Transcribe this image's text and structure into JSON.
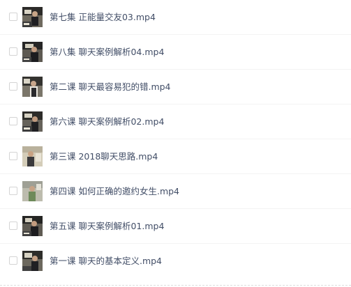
{
  "files": [
    {
      "name": "第七集 正能量交友03.mp4",
      "thumb_style": "dark"
    },
    {
      "name": "第八集 聊天案例解析04.mp4",
      "thumb_style": "dark"
    },
    {
      "name": "第二课 聊天最容易犯的错.mp4",
      "thumb_style": "dark"
    },
    {
      "name": "第六课 聊天案例解析02.mp4",
      "thumb_style": "dark"
    },
    {
      "name": "第三课 2018聊天思路.mp4",
      "thumb_style": "light"
    },
    {
      "name": "第四课 如何正确的邀约女生.mp4",
      "thumb_style": "light"
    },
    {
      "name": "第五课 聊天案例解析01.mp4",
      "thumb_style": "dark"
    },
    {
      "name": "第一课 聊天的基本定义.mp4",
      "thumb_style": "dark"
    }
  ]
}
